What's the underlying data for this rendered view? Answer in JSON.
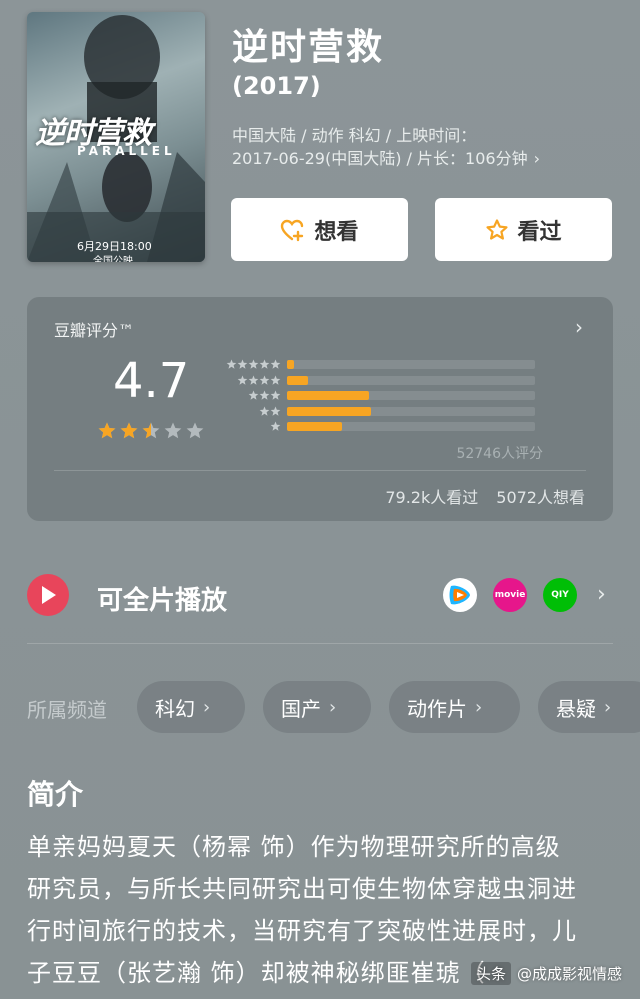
{
  "poster": {
    "title_art": "逆时营救",
    "subtitle_art": "PARALLEL",
    "release_art": "6月29日18:00",
    "release_art2": "全国公映"
  },
  "movie": {
    "title": "逆时营救",
    "year": "(2017)",
    "meta_line1": "中国大陆 / 动作 科幻 / 上映时间：",
    "meta_line2": "2017-06-29(中国大陆) / 片长：106分钟",
    "meta_chevron": "›"
  },
  "actions": {
    "want_label": "想看",
    "seen_label": "看过"
  },
  "rating": {
    "label": "豆瓣评分™",
    "score": "4.7",
    "stars_value": 2.5,
    "distribution": [
      {
        "stars": 5,
        "fraction": 0.03
      },
      {
        "stars": 4,
        "fraction": 0.085
      },
      {
        "stars": 3,
        "fraction": 0.33
      },
      {
        "stars": 2,
        "fraction": 0.34
      },
      {
        "stars": 1,
        "fraction": 0.22
      }
    ],
    "count_text": "52746人评分",
    "seen_text": "79.2k人看过",
    "want_text": "5072人想看",
    "star_color": "#f7a523"
  },
  "play": {
    "title": "可全片播放",
    "providers": [
      "tencent-video-icon",
      "youku-icon",
      "iqiyi-icon"
    ],
    "youku_text": "movie",
    "iqiyi_text": "QIY",
    "accent": "#e8455b"
  },
  "channels": {
    "label": "所属频道",
    "items": [
      "科幻",
      "国产",
      "动作片",
      "悬疑"
    ]
  },
  "synopsis": {
    "title": "简介",
    "line1": "单亲妈妈夏天（杨幂 饰）作为物理研究所的高级",
    "line2": "研究员，与所长共同研究出可使生物体穿越虫洞进",
    "line3": "行时间旅行的技术，当研究有了突破性进展时，儿",
    "line4": "子豆豆（张艺瀚 饰）却被神秘绑匪崔琥（"
  },
  "watermark": {
    "logo": "头条",
    "text": "@成成影视情感"
  }
}
